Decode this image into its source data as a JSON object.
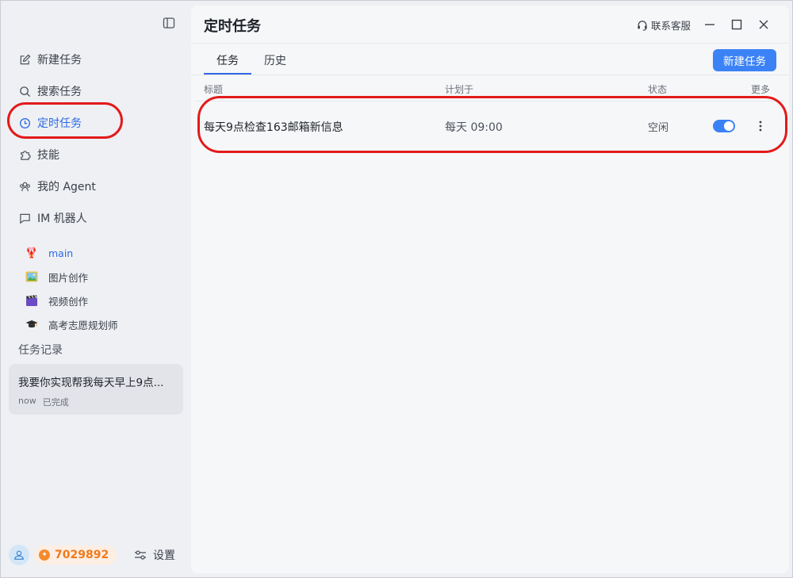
{
  "sidebar": {
    "nav": [
      {
        "label": "新建任务",
        "icon": "edit-icon"
      },
      {
        "label": "搜索任务",
        "icon": "search-icon"
      },
      {
        "label": "定时任务",
        "icon": "clock-icon"
      },
      {
        "label": "技能",
        "icon": "puzzle-icon"
      },
      {
        "label": "我的 Agent",
        "icon": "agents-icon"
      },
      {
        "label": "IM 机器人",
        "icon": "chat-icon"
      }
    ],
    "agents": [
      {
        "label": "main",
        "icon": "lobster-icon"
      },
      {
        "label": "图片创作",
        "icon": "picture-icon"
      },
      {
        "label": "视频创作",
        "icon": "clapperboard-icon"
      },
      {
        "label": "高考志愿规划师",
        "icon": "graduation-cap-icon"
      }
    ],
    "records_title": "任务记录",
    "record": {
      "title": "我要你实现帮我每天早上9点...",
      "time": "now",
      "status": "已完成"
    },
    "points": "7029892",
    "settings_label": "设置"
  },
  "header": {
    "title": "定时任务",
    "support_label": "联系客服"
  },
  "tabs": [
    {
      "label": "任务"
    },
    {
      "label": "历史"
    }
  ],
  "new_task_button": "新建任务",
  "table": {
    "columns": [
      "标题",
      "计划于",
      "状态",
      "更多"
    ],
    "rows": [
      {
        "title": "每天9点检查163邮箱新信息",
        "schedule": "每天 09:00",
        "status": "空闲",
        "enabled": true
      }
    ]
  },
  "colors": {
    "accent": "#3b82f6",
    "highlight": "#e31a1a",
    "points": "#f07a1c"
  }
}
